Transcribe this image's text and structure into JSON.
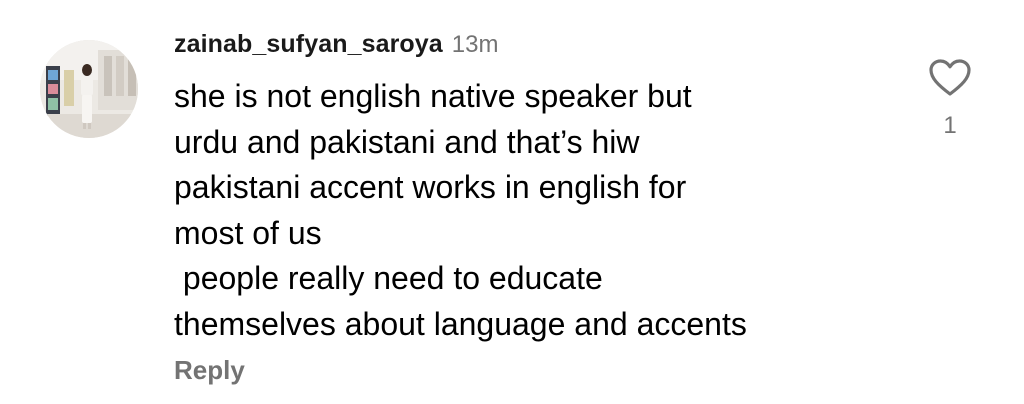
{
  "comment": {
    "username": "zainab_sufyan_saroya",
    "timestamp": "13m",
    "text_lines": [
      "she is not english native speaker but",
      "urdu and pakistani and that’s hiw",
      "pakistani accent works in english for",
      "most of us",
      " people really need to educate",
      "themselves about language and accents"
    ],
    "reply_label": "Reply",
    "like_count": "1",
    "like_icon": "heart-outline-icon"
  },
  "colors": {
    "username": "#1a1a1a",
    "muted": "#737373",
    "text": "#000000",
    "background": "#ffffff"
  }
}
